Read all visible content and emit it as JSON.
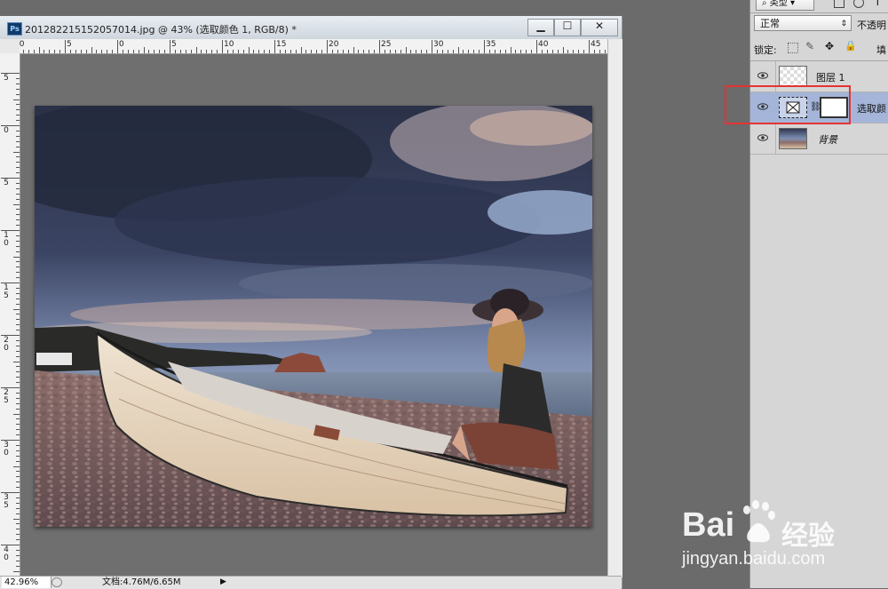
{
  "document": {
    "title": "201282215152057014.jpg @ 43% (选取颜色 1, RGB/8) *",
    "app_badge": "Ps",
    "minimize": "▁",
    "maximize": "☐",
    "close": "✕",
    "ruler_top_labels": [
      "10",
      "5",
      "0",
      "5",
      "10",
      "15",
      "20",
      "25",
      "30",
      "35",
      "40",
      "45",
      "50"
    ],
    "ruler_left_labels": [
      "5",
      "0",
      "5",
      "1\n0",
      "1\n5",
      "2\n0",
      "2\n5",
      "3\n0",
      "3\n5",
      "4\n0"
    ],
    "zoom": "42.96%",
    "doc_info": "文档:4.76M/6.65M"
  },
  "layers_panel": {
    "filter_label": "类型",
    "blend_mode": "正常",
    "opacity_label": "不透明",
    "lock_label": "锁定:",
    "fill_label": "填",
    "layers": [
      {
        "name": "图层 1",
        "selected": false
      },
      {
        "name": "选取颜",
        "selected": true
      },
      {
        "name": "背景",
        "selected": false
      }
    ]
  },
  "watermark": {
    "brand": "Bai",
    "brand_suffix": "经验",
    "url": "jingyan.baidu.com"
  },
  "colors": {
    "selection_highlight": "#e53333",
    "selected_layer": "#a4b5d9"
  }
}
